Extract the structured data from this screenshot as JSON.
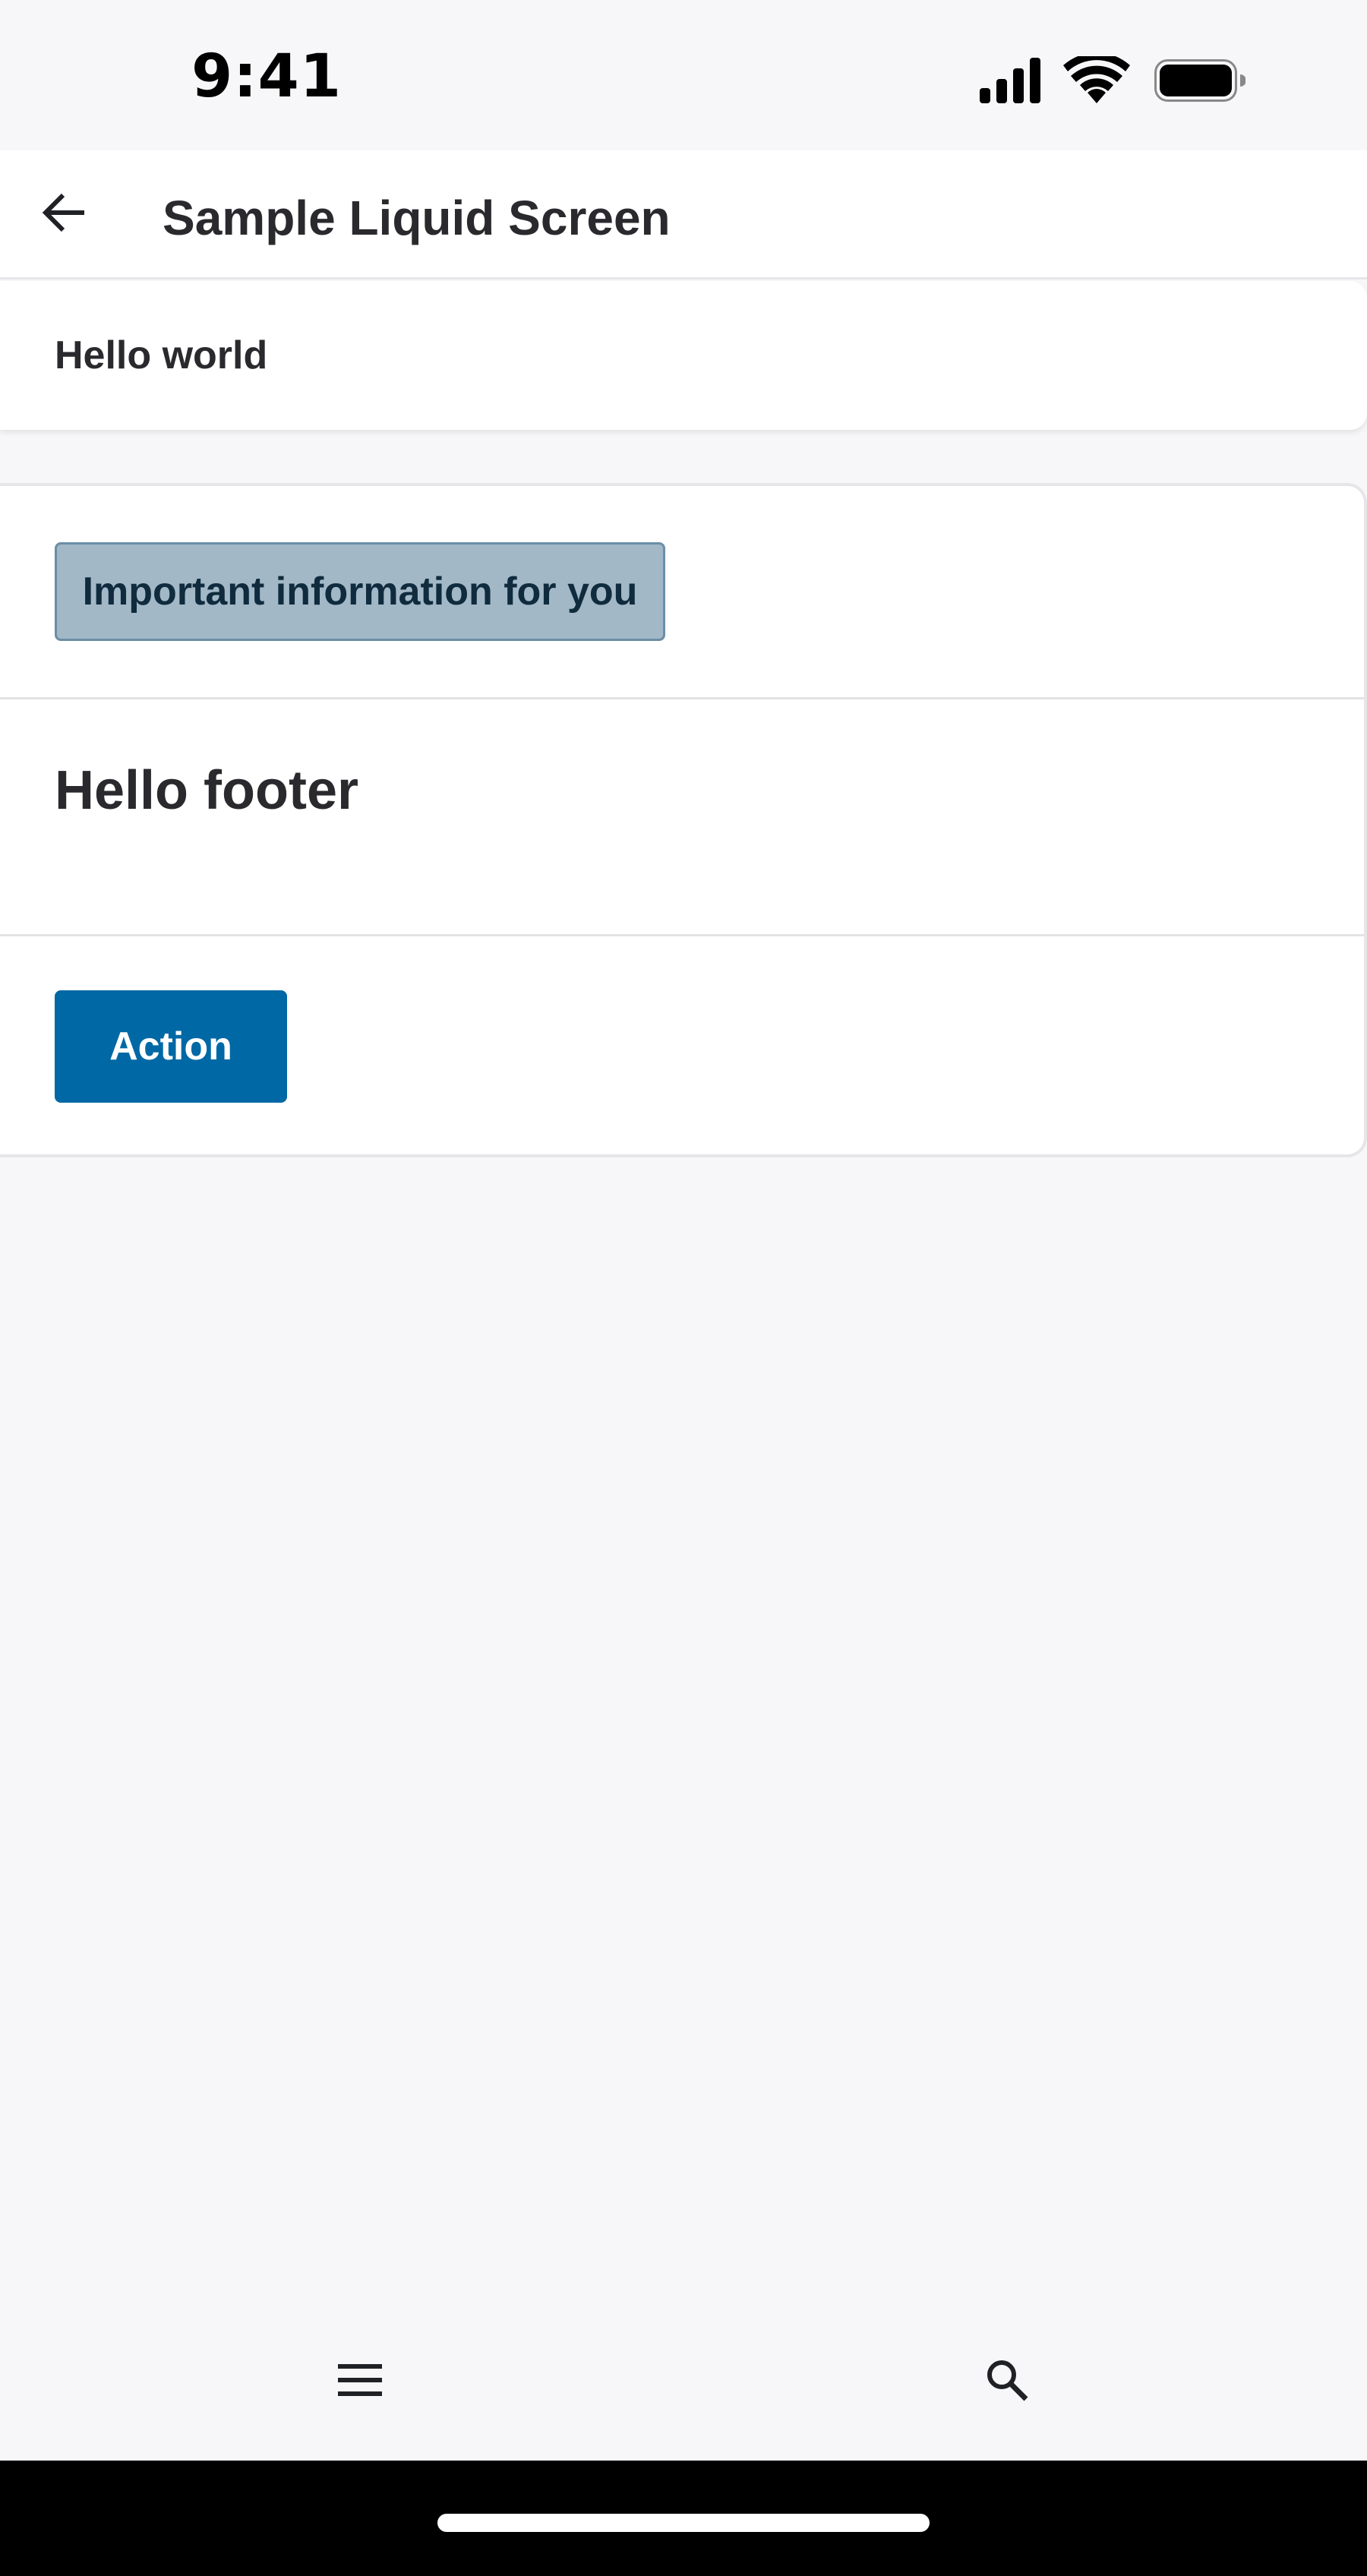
{
  "status_bar": {
    "time": "9:41",
    "icons": [
      "cellular-signal-icon",
      "wifi-icon",
      "battery-icon"
    ]
  },
  "header": {
    "title": "Sample Liquid Screen",
    "back_icon": "back-arrow-icon"
  },
  "card1": {
    "text": "Hello world"
  },
  "card2": {
    "info_badge": "Important information for you",
    "footer_text": "Hello footer",
    "action_label": "Action"
  },
  "bottom_nav": {
    "items": [
      {
        "icon": "menu-icon"
      },
      {
        "icon": "search-icon"
      }
    ]
  },
  "colors": {
    "primary": "#0068a5",
    "info_bg": "#a2b8c7",
    "info_border": "#6b8ea6",
    "background": "#f7f7f9"
  }
}
